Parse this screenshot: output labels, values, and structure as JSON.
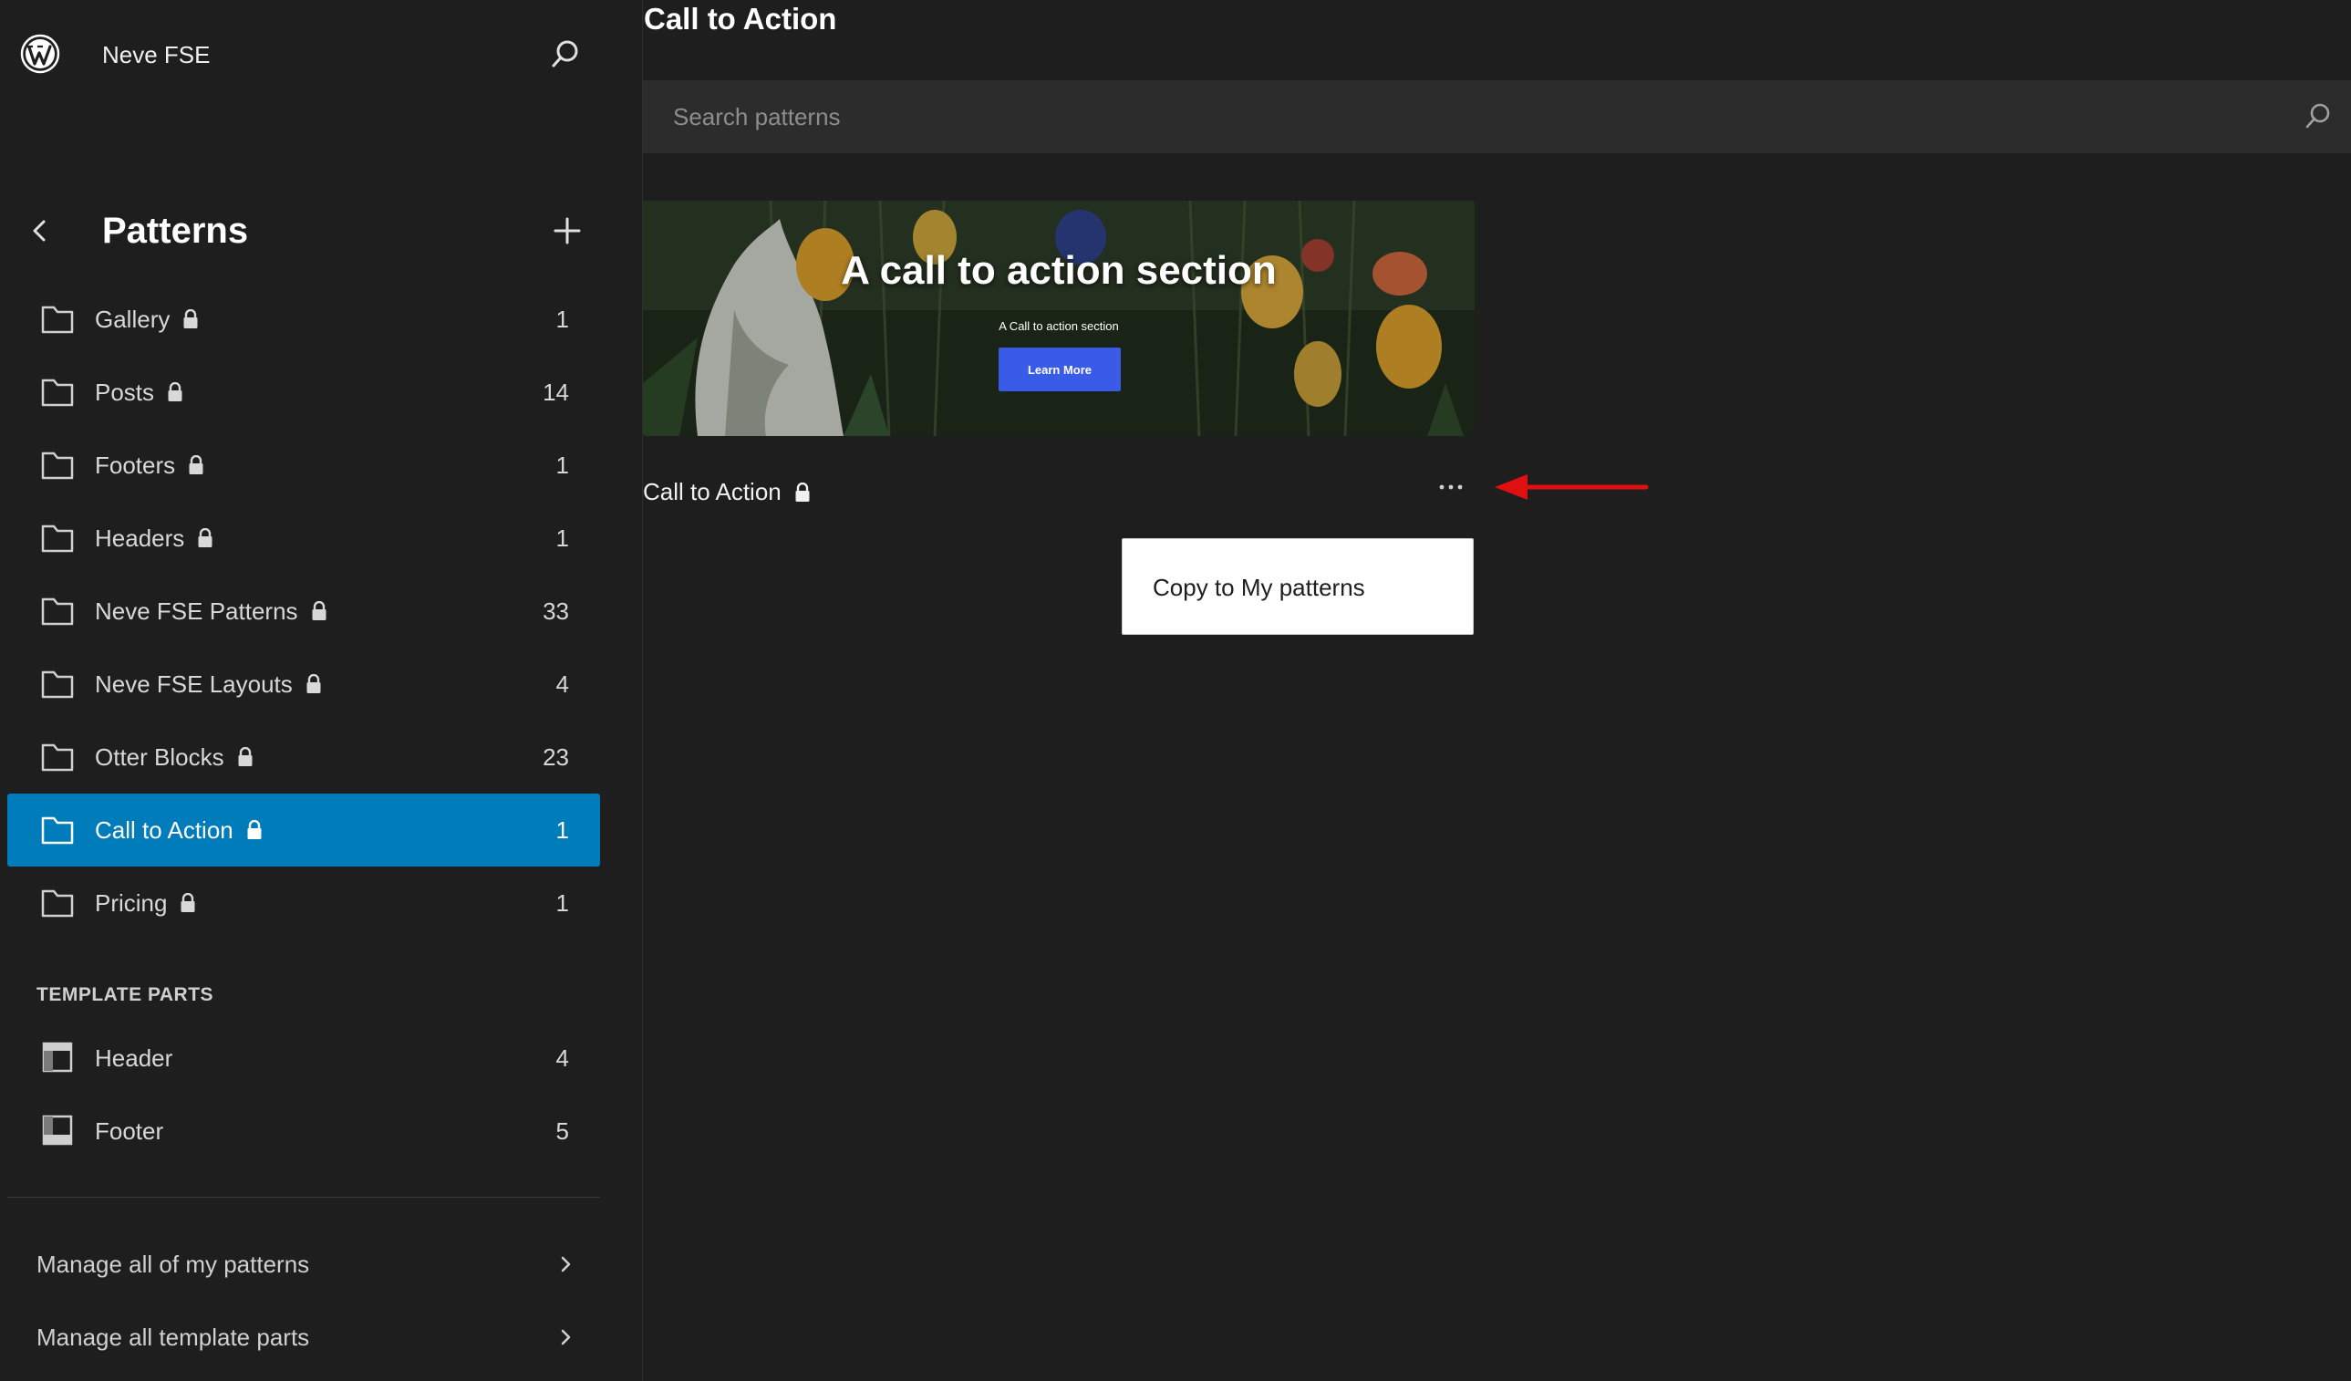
{
  "site": {
    "title": "Neve FSE"
  },
  "patterns_panel": {
    "title": "Patterns",
    "categories": [
      {
        "label": "Gallery",
        "count": "1",
        "locked": true
      },
      {
        "label": "Posts",
        "count": "14",
        "locked": true
      },
      {
        "label": "Footers",
        "count": "1",
        "locked": true
      },
      {
        "label": "Headers",
        "count": "1",
        "locked": true
      },
      {
        "label": "Neve FSE Patterns",
        "count": "33",
        "locked": true
      },
      {
        "label": "Neve FSE Layouts",
        "count": "4",
        "locked": true
      },
      {
        "label": "Otter Blocks",
        "count": "23",
        "locked": true
      },
      {
        "label": "Call to Action",
        "count": "1",
        "locked": true,
        "active": true
      },
      {
        "label": "Pricing",
        "count": "1",
        "locked": true
      }
    ],
    "template_parts_heading": "TEMPLATE PARTS",
    "template_parts": [
      {
        "label": "Header",
        "count": "4"
      },
      {
        "label": "Footer",
        "count": "5"
      }
    ],
    "manage_links": [
      {
        "label": "Manage all of my patterns"
      },
      {
        "label": "Manage all template parts"
      }
    ]
  },
  "main": {
    "page_title": "Call to Action",
    "search": {
      "placeholder": "Search patterns",
      "value": ""
    },
    "pattern": {
      "preview_heading": "A call to action section",
      "preview_subtext": "A Call to action section",
      "preview_button": "Learn More",
      "title": "Call to Action",
      "locked": true
    },
    "dropdown": {
      "items": [
        "Copy to My patterns"
      ]
    }
  },
  "colors": {
    "background": "#1e1e1e",
    "active_item": "#007cba",
    "search_bg": "#2c2c2c",
    "preview_button": "#3a5be8",
    "annotation_arrow": "#e01010"
  },
  "icons": {
    "logo": "wordpress-logo-icon",
    "site_search": "search-icon",
    "back": "chevron-left-icon",
    "add": "plus-icon",
    "category": "folder-icon",
    "lock": "lock-icon",
    "template_header": "header-layout-icon",
    "template_footer": "footer-layout-icon",
    "manage_chevron": "chevron-right-icon",
    "more": "more-horizontal-icon"
  }
}
